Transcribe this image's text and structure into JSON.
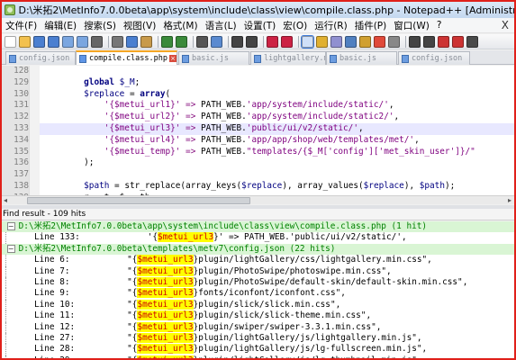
{
  "window": {
    "title": "D:\\米拓2\\MetInfo7.0.0beta\\app\\system\\include\\class\\view\\compile.class.php - Notepad++ [Administrator]"
  },
  "menu": {
    "items": [
      "文件(F)",
      "编辑(E)",
      "搜索(S)",
      "视图(V)",
      "格式(M)",
      "语言(L)",
      "设置(T)",
      "宏(O)",
      "运行(R)",
      "插件(P)",
      "窗口(W)",
      "?"
    ],
    "close": "X"
  },
  "toolbar": {
    "icons": [
      "new-file-icon",
      "open-file-icon",
      "save-icon",
      "save-all-icon",
      "close-icon",
      "close-all-icon",
      "print-icon",
      "cut-icon",
      "copy-icon",
      "paste-icon",
      "undo-icon",
      "redo-icon",
      "find-icon",
      "replace-icon",
      "zoom-in-icon",
      "zoom-out-icon",
      "sync-v-icon",
      "sync-h-icon",
      "word-wrap-icon",
      "show-all-chars-icon",
      "indent-guide-icon",
      "doc-map-icon",
      "function-list-icon",
      "folder-workspace-icon",
      "monitor-icon",
      "record-macro-icon",
      "stop-macro-icon",
      "play-macro-icon",
      "play-multi-icon",
      "save-macro-icon"
    ]
  },
  "tabs": [
    {
      "label": "config.json",
      "active": false
    },
    {
      "label": "compile.class.php",
      "active": true
    },
    {
      "label": "basic.js",
      "active": false
    },
    {
      "label": "lightgallery.min.js",
      "active": false
    },
    {
      "label": "basic.js",
      "active": false
    },
    {
      "label": "config.json",
      "active": false
    }
  ],
  "editor": {
    "lines": [
      {
        "num": "128",
        "tokens": []
      },
      {
        "num": "129",
        "tokens": [
          [
            "kw",
            "        global "
          ],
          [
            "var",
            "$_M"
          ],
          [
            "plain",
            ";"
          ]
        ]
      },
      {
        "num": "130",
        "tokens": [
          [
            "var",
            "        $replace"
          ],
          [
            "plain",
            " = "
          ],
          [
            "kw",
            "array"
          ],
          [
            "plain",
            "("
          ]
        ]
      },
      {
        "num": "131",
        "tokens": [
          [
            "str",
            "            '{$metui_url1}'"
          ],
          [
            "op",
            " => "
          ],
          [
            "plain",
            "PATH_WEB."
          ],
          [
            "str",
            "'app/system/include/static/'"
          ],
          [
            "plain",
            ","
          ]
        ]
      },
      {
        "num": "132",
        "tokens": [
          [
            "str",
            "            '{$metui_url2}'"
          ],
          [
            "op",
            " => "
          ],
          [
            "plain",
            "PATH_WEB."
          ],
          [
            "str",
            "'app/system/include/static2/'"
          ],
          [
            "plain",
            ","
          ]
        ]
      },
      {
        "num": "133",
        "tokens": [
          [
            "str",
            "            '{$metui_url3}'"
          ],
          [
            "op",
            " => "
          ],
          [
            "plain",
            "PATH_WEB."
          ],
          [
            "str",
            "'public/ui/v2/static/'"
          ],
          [
            "plain",
            ","
          ]
        ],
        "highlight": true
      },
      {
        "num": "134",
        "tokens": [
          [
            "str",
            "            '{$metui_url4}'"
          ],
          [
            "op",
            " => "
          ],
          [
            "plain",
            "PATH_WEB."
          ],
          [
            "str",
            "'app/app/shop/web/templates/met/'"
          ],
          [
            "plain",
            ","
          ]
        ]
      },
      {
        "num": "135",
        "tokens": [
          [
            "str",
            "            '{$metui_temp}'"
          ],
          [
            "op",
            " => "
          ],
          [
            "plain",
            "PATH_WEB."
          ],
          [
            "str",
            "\"templates/{$_M['config']['met_skin_user']}/\""
          ]
        ]
      },
      {
        "num": "136",
        "tokens": [
          [
            "plain",
            "        );"
          ]
        ]
      },
      {
        "num": "137",
        "tokens": []
      },
      {
        "num": "138",
        "tokens": [
          [
            "var",
            "        $path"
          ],
          [
            "plain",
            " = "
          ],
          [
            "fn",
            "str_replace"
          ],
          [
            "plain",
            "("
          ],
          [
            "fn",
            "array_keys"
          ],
          [
            "plain",
            "("
          ],
          [
            "var",
            "$replace"
          ],
          [
            "plain",
            "), "
          ],
          [
            "fn",
            "array_values"
          ],
          [
            "plain",
            "("
          ],
          [
            "var",
            "$replace"
          ],
          [
            "plain",
            "), "
          ],
          [
            "var",
            "$path"
          ],
          [
            "plain",
            ");"
          ]
        ]
      },
      {
        "num": "139",
        "tokens": [
          [
            "plain",
            "        r   t  $   th"
          ]
        ]
      }
    ]
  },
  "find": {
    "header": "Find result - 109 hits",
    "rows": [
      {
        "kind": "file",
        "box": "−",
        "pre": "D:\\",
        "cjk": "米拓",
        "post": "2\\MetInfo7.0.0beta\\app\\system\\include\\class\\view\\compile.class.php (1 hit)"
      },
      {
        "kind": "line",
        "label": "Line 133:",
        "pre": "            '{",
        "hit": "$metui_url3",
        "post": "}' => PATH_WEB.'public/ui/v2/static/',"
      },
      {
        "kind": "file",
        "box": "−",
        "pre": "D:\\",
        "cjk": "米拓",
        "post": "2\\MetInfo7.0.0beta\\templates\\metv7\\config.json (22 hits)"
      },
      {
        "kind": "line",
        "label": "Line 6:",
        "pre": "        \"{",
        "hit": "$metui_url3",
        "post": "}plugin/lightGallery/css/lightgallery.min.css\","
      },
      {
        "kind": "line",
        "label": "Line 7:",
        "pre": "        \"{",
        "hit": "$metui_url3",
        "post": "}plugin/PhotoSwipe/photoswipe.min.css\","
      },
      {
        "kind": "line",
        "label": "Line 8:",
        "pre": "        \"{",
        "hit": "$metui_url3",
        "post": "}plugin/PhotoSwipe/default-skin/default-skin.min.css\","
      },
      {
        "kind": "line",
        "label": "Line 9:",
        "pre": "        \"{",
        "hit": "$metui_url3",
        "post": "}fonts/iconfont/iconfont.css\","
      },
      {
        "kind": "line",
        "label": "Line 10:",
        "pre": "        \"{",
        "hit": "$metui_url3",
        "post": "}plugin/slick/slick.min.css\","
      },
      {
        "kind": "line",
        "label": "Line 11:",
        "pre": "        \"{",
        "hit": "$metui_url3",
        "post": "}plugin/slick/slick-theme.min.css\","
      },
      {
        "kind": "line",
        "label": "Line 12:",
        "pre": "        \"{",
        "hit": "$metui_url3",
        "post": "}plugin/swiper/swiper-3.3.1.min.css\","
      },
      {
        "kind": "line",
        "label": "Line 27:",
        "pre": "        \"{",
        "hit": "$metui_url3",
        "post": "}plugin/lightGallery/js/lightgallery.min.js\","
      },
      {
        "kind": "line",
        "label": "Line 28:",
        "pre": "        \"{",
        "hit": "$metui_url3",
        "post": "}plugin/lightGallery/js/lg-fullscreen.min.js\","
      },
      {
        "kind": "line",
        "label": "Line 29:",
        "pre": "        \"{",
        "hit": "$metui_url3",
        "post": "}plugin/lightGallery/js/lg-thumbnail.min.js\","
      }
    ]
  },
  "colors": {
    "highlight_line": "#e8e8ff",
    "file_row": "#d9f5d4",
    "hit_background": "#ffff00",
    "hit_text": "#d00000",
    "window_border": "#e0201a"
  }
}
